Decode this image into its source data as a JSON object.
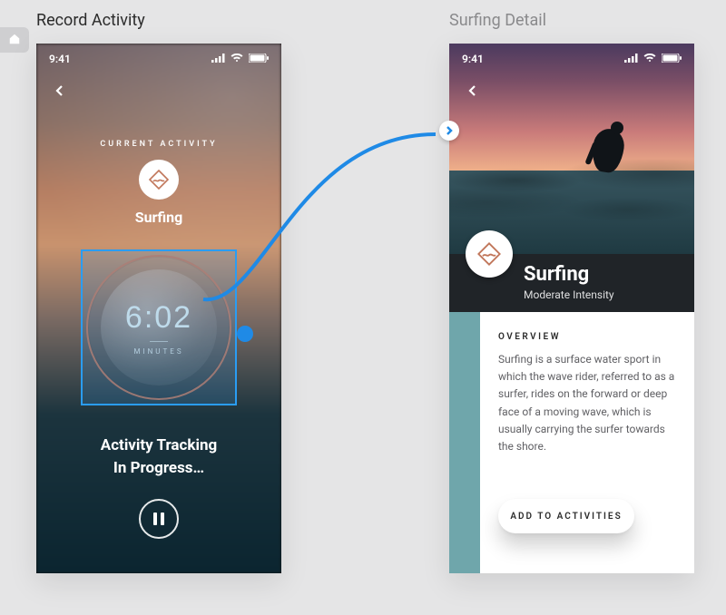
{
  "labels": {
    "left": "Record Activity",
    "right": "Surfing Detail"
  },
  "status": {
    "time": "9:41"
  },
  "record": {
    "section_label": "CURRENT ACTIVITY",
    "activity_name": "Surfing",
    "timer_value": "6:02",
    "timer_unit": "MINUTES",
    "status_line1": "Activity Tracking",
    "status_line2": "In Progress…"
  },
  "detail": {
    "title": "Surfing",
    "subtitle": "Moderate Intensity",
    "overview_label": "OVERVIEW",
    "overview_text": "Surfing is a surface water sport in which the wave rider, referred to as a surfer, rides on the forward or deep face of a moving wave, which is usually carrying the surfer towards the shore.",
    "add_button": "ADD TO ACTIVITIES"
  },
  "icons": {
    "home": "home-icon",
    "back": "chevron-left-icon",
    "pause": "pause-icon",
    "surfing": "wave-diamond-icon",
    "link_arrow": "chevron-right-icon"
  },
  "colors": {
    "link_blue": "#1f8ae6",
    "teal_stripe": "#6fa6ab",
    "dial_ring": "#c9846a"
  }
}
